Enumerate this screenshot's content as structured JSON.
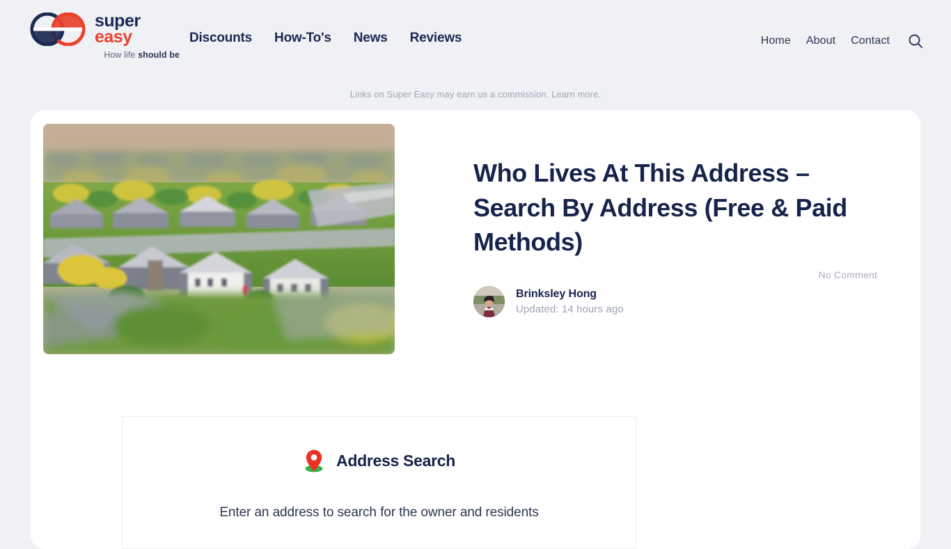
{
  "header": {
    "brand": {
      "logo_icon": "super-easy-double-e-logo",
      "name_line1": "super",
      "name_line2": "easy",
      "tagline_prefix": "How life ",
      "tagline_strong": "should be",
      "navy": "#1b2a52",
      "red": "#e8432e"
    },
    "main_nav": [
      {
        "label": "Discounts"
      },
      {
        "label": "How-To's"
      },
      {
        "label": "News"
      },
      {
        "label": "Reviews"
      }
    ],
    "util_nav": [
      {
        "label": "Home"
      },
      {
        "label": "About"
      },
      {
        "label": "Contact"
      }
    ],
    "search_icon": "search-icon"
  },
  "disclaimer": {
    "text": "Links on Super Easy may earn us a commission.",
    "link_label": "Learn more."
  },
  "article": {
    "hero_image_alt": "Tilt-shift aerial photograph of a suburban neighborhood with houses, lawns and autumn trees",
    "title": "Who Lives At This Address – Search By Address (Free & Paid Methods)",
    "author": "Brinksley Hong",
    "updated": "Updated: 14 hours ago",
    "avatar_alt": "Portrait photo of Brinksley Hong",
    "comments": "No Comment"
  },
  "address_widget": {
    "icon": "map-pin-icon",
    "title": "Address Search",
    "subtitle": "Enter an address to search for the owner and residents"
  },
  "colors": {
    "page_bg": "#f0f1f5",
    "card_bg": "#ffffff",
    "navy": "#16234a",
    "muted": "#9ea4b4",
    "accent_red": "#e8432e",
    "pin_green": "#34b44a"
  }
}
